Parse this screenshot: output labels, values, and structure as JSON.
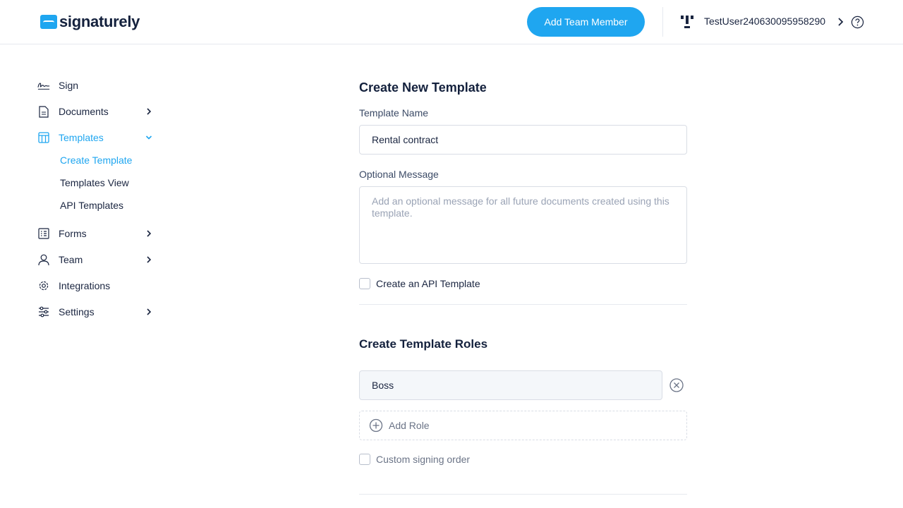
{
  "header": {
    "logo_text": "signaturely",
    "add_member_label": "Add Team Member",
    "user_name": "TestUser240630095958290"
  },
  "sidebar": {
    "items": [
      {
        "label": "Sign",
        "icon": "signature-icon"
      },
      {
        "label": "Documents",
        "icon": "document-icon"
      },
      {
        "label": "Templates",
        "icon": "template-icon"
      },
      {
        "label": "Forms",
        "icon": "form-icon"
      },
      {
        "label": "Team",
        "icon": "user-icon"
      },
      {
        "label": "Integrations",
        "icon": "gear-icon"
      },
      {
        "label": "Settings",
        "icon": "sliders-icon"
      }
    ],
    "template_sub_items": [
      "Create Template",
      "Templates View",
      "API Templates"
    ]
  },
  "form": {
    "title": "Create New Template",
    "template_name_label": "Template Name",
    "template_name_value": "Rental contract",
    "optional_message_label": "Optional Message",
    "optional_message_placeholder": "Add an optional message for all future documents created using this template.",
    "api_template_label": "Create an API Template",
    "roles_title": "Create Template Roles",
    "role_value": "Boss",
    "add_role_label": "Add Role",
    "custom_order_label": "Custom signing order"
  },
  "colors": {
    "accent": "#1fa6f0",
    "text": "#1a2540"
  }
}
